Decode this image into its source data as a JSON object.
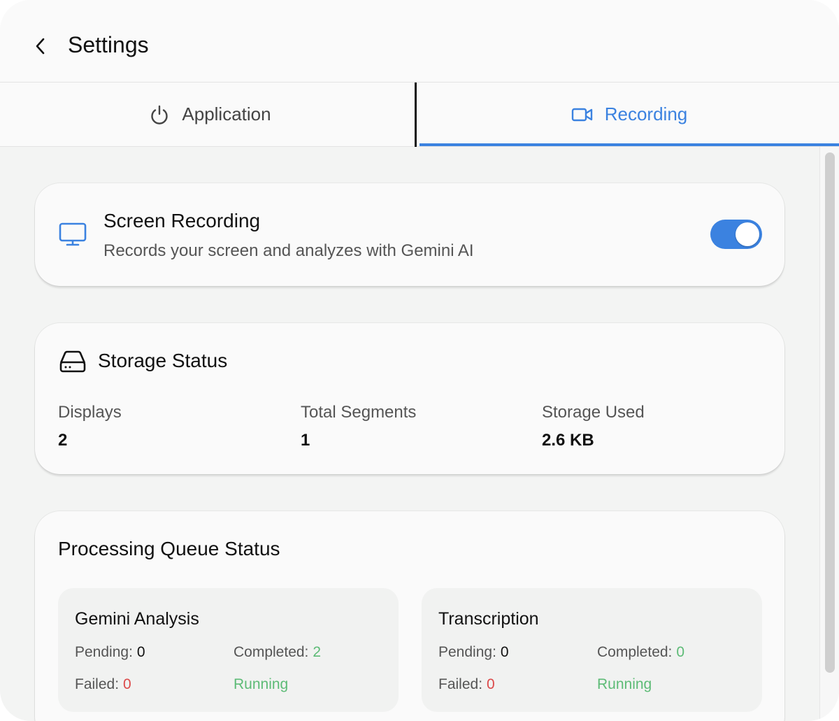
{
  "header": {
    "title": "Settings",
    "back_icon": "chevron-left-icon"
  },
  "tabs": [
    {
      "label": "Application",
      "icon": "power-icon",
      "active": false
    },
    {
      "label": "Recording",
      "icon": "video-camera-icon",
      "active": true
    }
  ],
  "colors": {
    "accent": "#3b82e0",
    "success": "#5dbb76",
    "error": "#dc4a4a"
  },
  "screen_recording": {
    "title": "Screen Recording",
    "description": "Records your screen and analyzes with Gemini AI",
    "icon": "monitor-icon",
    "enabled": true
  },
  "storage": {
    "title": "Storage Status",
    "icon": "hard-drive-icon",
    "displays_label": "Displays",
    "displays_value": "2",
    "segments_label": "Total Segments",
    "segments_value": "1",
    "used_label": "Storage Used",
    "used_value": "2.6 KB"
  },
  "queue": {
    "title": "Processing Queue Status",
    "gemini": {
      "title": "Gemini Analysis",
      "pending_label": "Pending:",
      "pending_value": "0",
      "completed_label": "Completed:",
      "completed_value": "2",
      "failed_label": "Failed:",
      "failed_value": "0",
      "status": "Running"
    },
    "transcription": {
      "title": "Transcription",
      "pending_label": "Pending:",
      "pending_value": "0",
      "completed_label": "Completed:",
      "completed_value": "0",
      "failed_label": "Failed:",
      "failed_value": "0",
      "status": "Running"
    }
  }
}
